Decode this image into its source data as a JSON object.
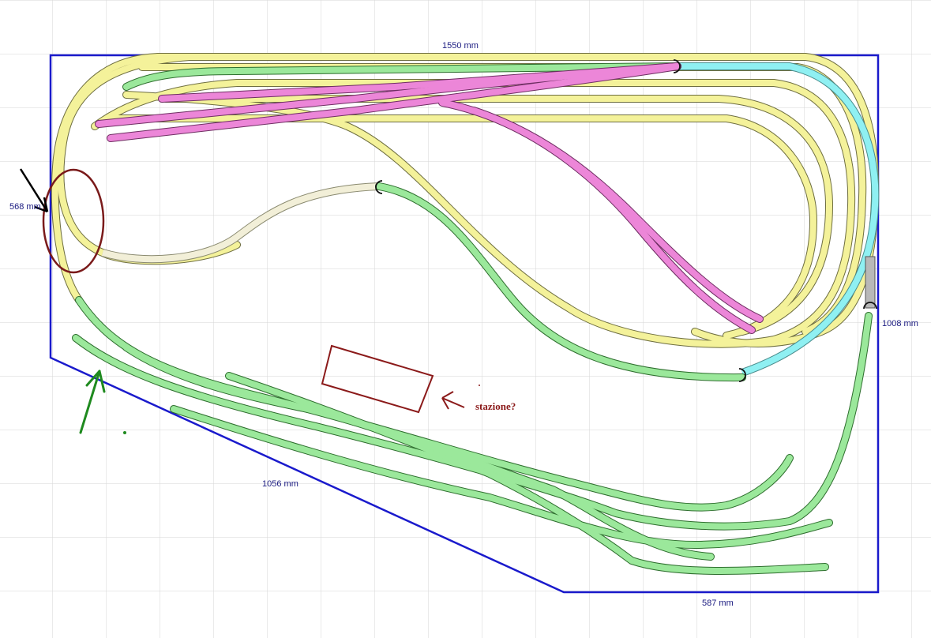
{
  "dimensions": {
    "top": "1550 mm",
    "left": "568 mm",
    "right": "1008 mm",
    "diagonal": "1056 mm",
    "bottom": "587 mm"
  },
  "annotations": {
    "station_label": "stazione?"
  },
  "colors": {
    "grid": "#d6d6d6",
    "board_outline": "#1a1acc",
    "track_yellow": "#f4f29a",
    "track_green": "#9be89b",
    "track_magenta": "#ec86d8",
    "track_cyan": "#8ff0f2",
    "track_cream": "#f2efd8",
    "track_gray": "#b8b8b8",
    "annotation_red": "#8b1a1a",
    "annotation_green": "#1f8a1f"
  }
}
